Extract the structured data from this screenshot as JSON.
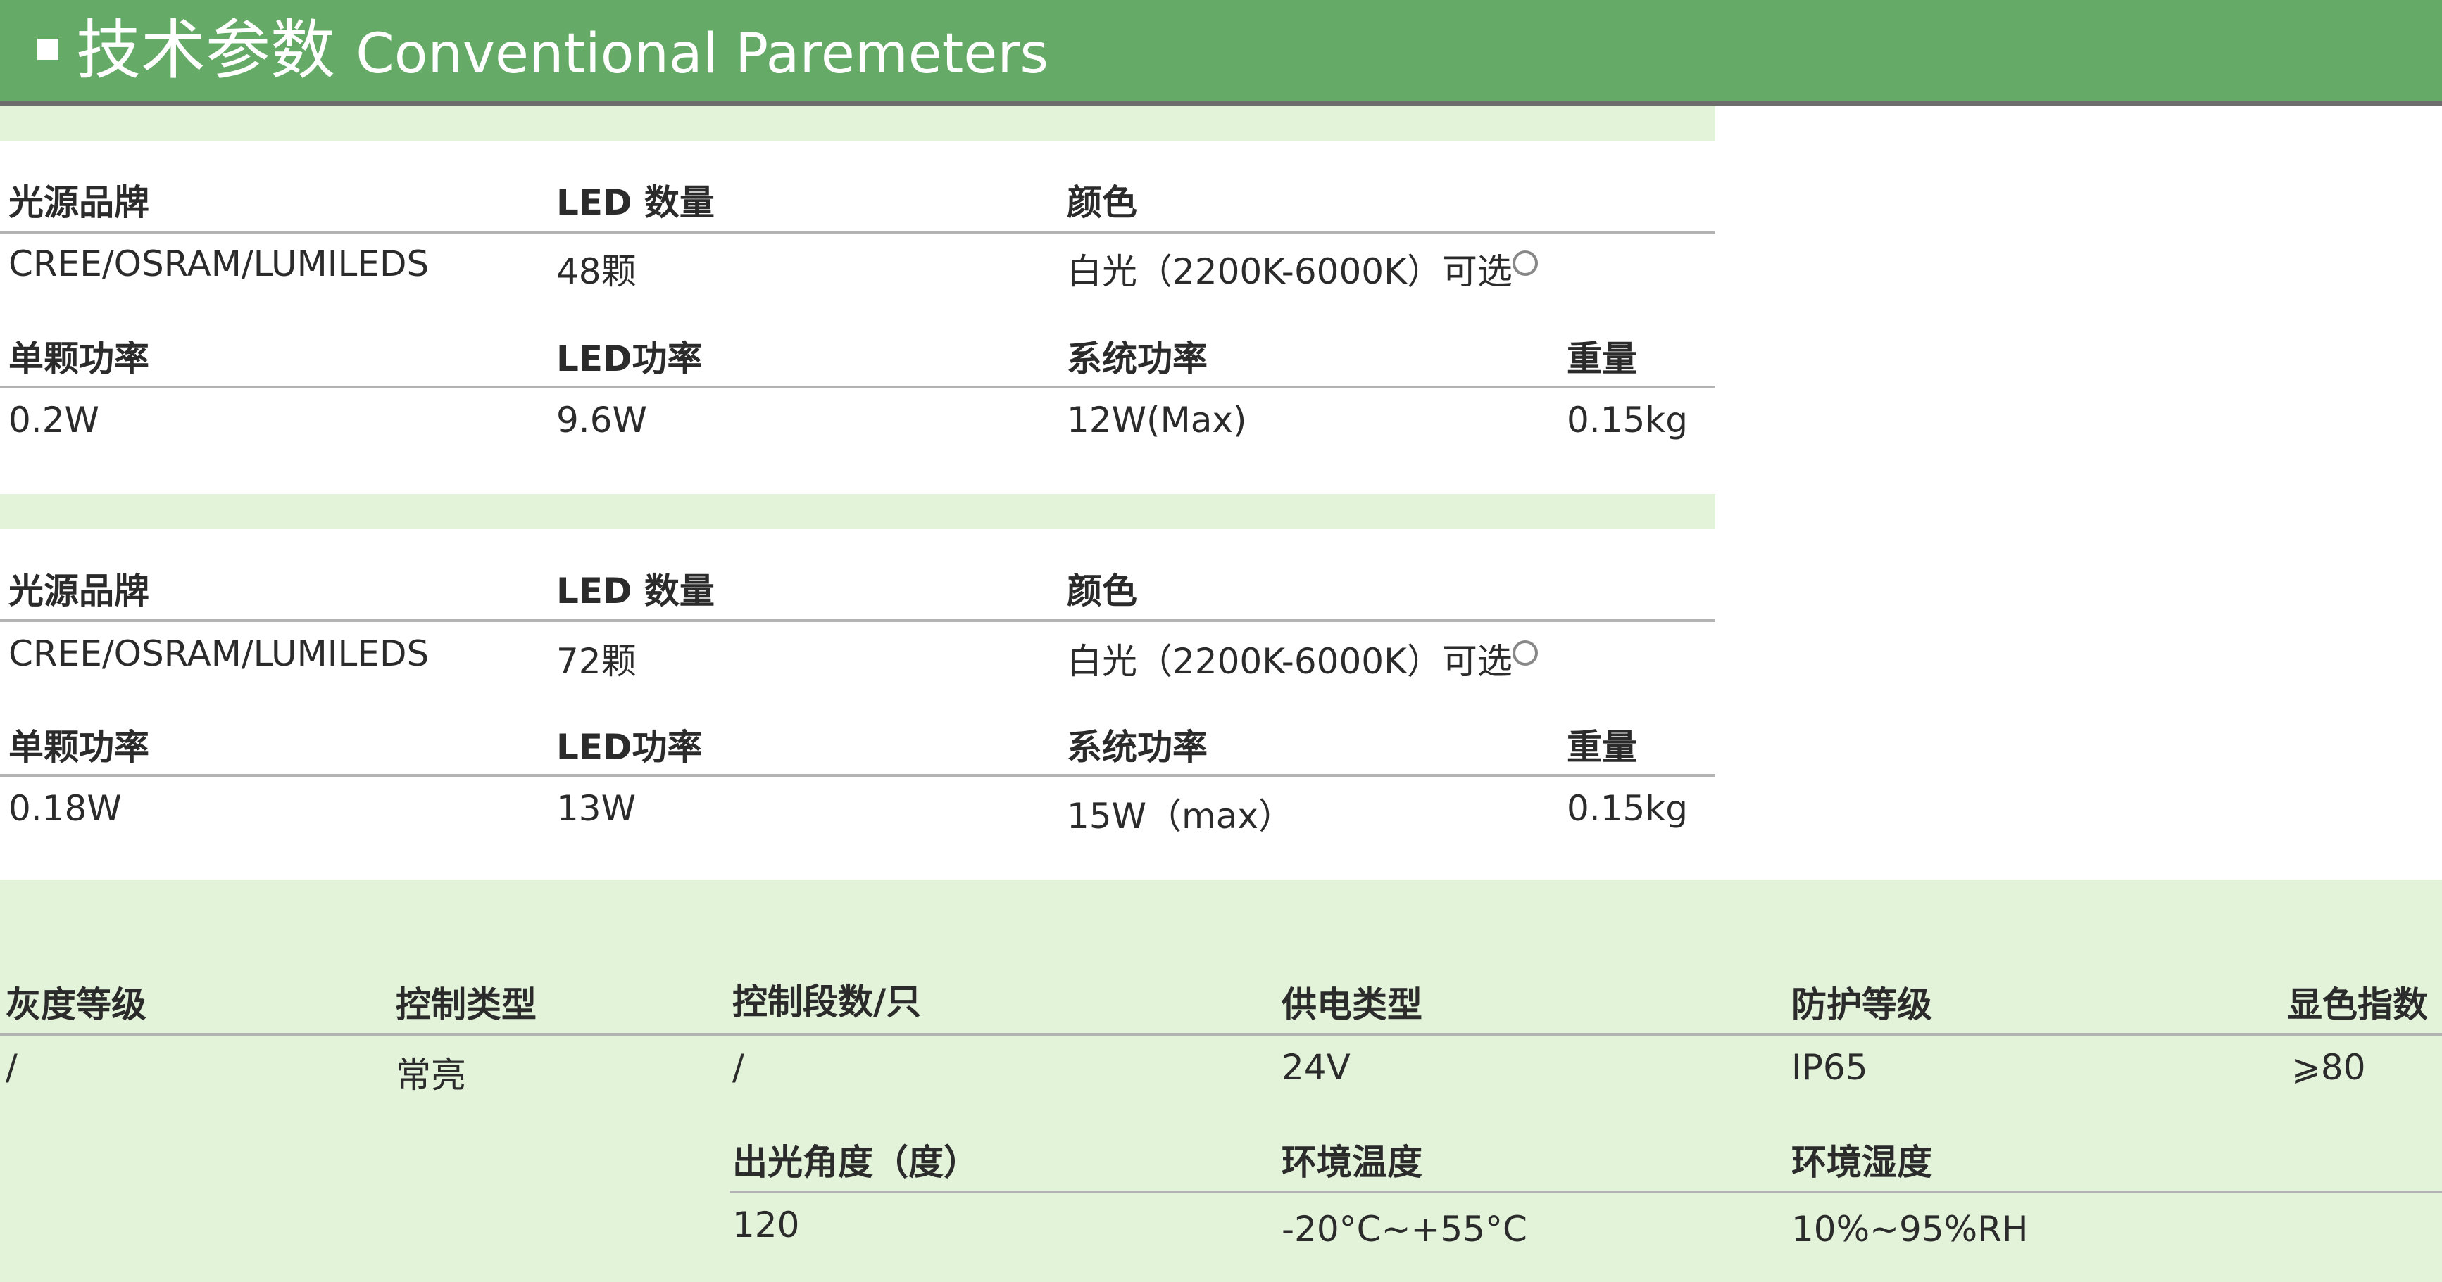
{
  "header": {
    "title_zh": "技术参数",
    "title_en": "Conventional Paremeters"
  },
  "spec_tables": [
    {
      "row1_labels": [
        "光源品牌",
        "LED 数量",
        "颜色"
      ],
      "row1_values": [
        "CREE/OSRAM/LUMILEDS",
        "48颗",
        "白光（2200K-6000K）可选"
      ],
      "row2_labels": [
        "单颗功率",
        "LED功率",
        "系统功率",
        "重量"
      ],
      "row2_values": [
        "0.2W",
        "9.6W",
        "12W(Max)",
        "0.15kg"
      ]
    },
    {
      "row1_labels": [
        "光源品牌",
        "LED 数量",
        "颜色"
      ],
      "row1_values": [
        "CREE/OSRAM/LUMILEDS",
        "72颗",
        "白光（2200K-6000K）可选"
      ],
      "row2_labels": [
        "单颗功率",
        "LED功率",
        "系统功率",
        "重量"
      ],
      "row2_values": [
        "0.18W",
        "13W",
        "15W（max）",
        "0.15kg"
      ]
    }
  ],
  "bottom_table": {
    "row1_labels": [
      "灰度等级",
      "控制类型",
      "控制段数/只",
      "供电类型",
      "防护等级",
      "显色指数"
    ],
    "row1_values": [
      "/",
      "常亮",
      "/",
      "24V",
      "IP65",
      "⩾80"
    ],
    "row2_labels": [
      "出光角度（度）",
      "环境温度",
      "环境湿度"
    ],
    "row2_values": [
      "120",
      "-20°C~+55°C",
      "10%~95%RH"
    ]
  }
}
